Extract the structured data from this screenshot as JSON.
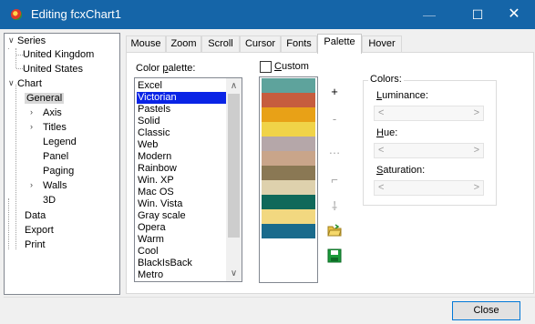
{
  "window": {
    "title": "Editing fcxChart1",
    "minimize": "—",
    "maximize": "☐",
    "close": "✕"
  },
  "tree": {
    "series": "Series",
    "uk": "United Kingdom",
    "us": "United States",
    "chart": "Chart",
    "general": "General",
    "axis": "Axis",
    "titles": "Titles",
    "legend": "Legend",
    "panel": "Panel",
    "paging": "Paging",
    "walls": "Walls",
    "d3": "3D",
    "data": "Data",
    "export": "Export",
    "print": "Print",
    "collapse_glyph": "∨",
    "expand_glyph": "›"
  },
  "tabs": [
    "Mouse",
    "Zoom",
    "Scroll",
    "Cursor",
    "Fonts",
    "Palette",
    "Hover"
  ],
  "palette": {
    "label_pre": "Color ",
    "label_u": "p",
    "label_post": "alette:",
    "items": [
      "Excel",
      "Victorian",
      "Pastels",
      "Solid",
      "Classic",
      "Web",
      "Modern",
      "Rainbow",
      "Win. XP",
      "Mac OS",
      "Win. Vista",
      "Gray scale",
      "Opera",
      "Warm",
      "Cool",
      "BlackIsBack",
      "Metro"
    ],
    "selected": "Victorian",
    "scroll_up": "∧",
    "scroll_down": "∨",
    "custom_u": "C",
    "custom_rest": "ustom",
    "swatch_colors": [
      "#5ea39c",
      "#c65d3e",
      "#e8a117",
      "#f0d348",
      "#b5a7a9",
      "#c9a58a",
      "#8a7854",
      "#ded1ad",
      "#10695a",
      "#f2d880",
      "#1a6b8c"
    ]
  },
  "tools": {
    "add": "+",
    "remove": "-",
    "edit": "…",
    "up": "⌐",
    "down": "⸸"
  },
  "colors": {
    "title": "Colors:",
    "lum_u": "L",
    "lum_rest": "uminance:",
    "hue_u": "H",
    "hue_rest": "ue:",
    "sat_u": "S",
    "sat_rest": "aturation:",
    "left": "<",
    "right": ">"
  },
  "footer": {
    "close": "Close"
  }
}
